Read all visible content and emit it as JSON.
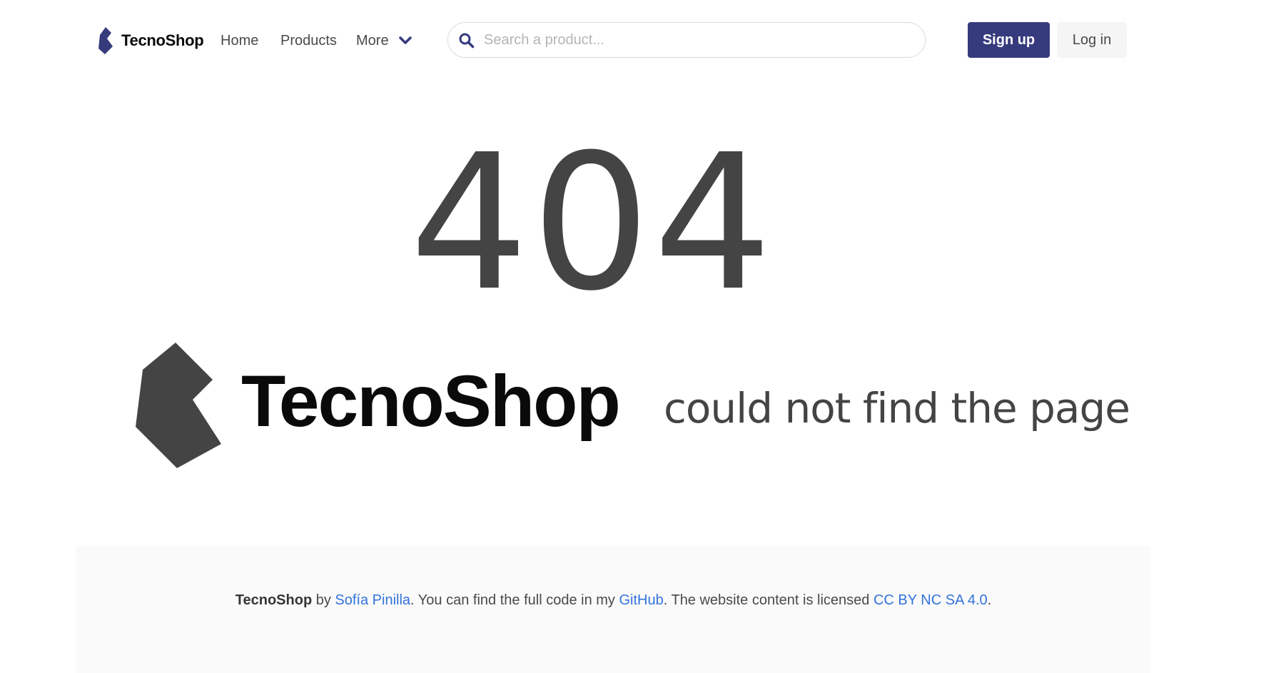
{
  "brand": {
    "name": "TecnoShop"
  },
  "nav": {
    "home": "Home",
    "products": "Products",
    "more": "More"
  },
  "search": {
    "placeholder": "Search a product..."
  },
  "auth": {
    "signup": "Sign up",
    "login": "Log in"
  },
  "hero": {
    "code": "404",
    "brand": "TecnoShop",
    "message": "could not find the page"
  },
  "footer": {
    "brand": "TecnoShop",
    "by": " by ",
    "author": "Sofía Pinilla",
    "text1": ". You can find the full code in my ",
    "github": "GitHub",
    "text2": ". The website content is licensed ",
    "license": "CC BY NC SA 4.0",
    "end": "."
  },
  "colors": {
    "primary": "#363b7e",
    "link": "#3273dc",
    "text": "#4a4a4a",
    "logo_nav": "#363b7e",
    "logo_big": "#444444"
  },
  "icons": {
    "search": "search-icon",
    "more": "chevron-down-icon",
    "logo": "tecnoshop-logo-icon"
  }
}
